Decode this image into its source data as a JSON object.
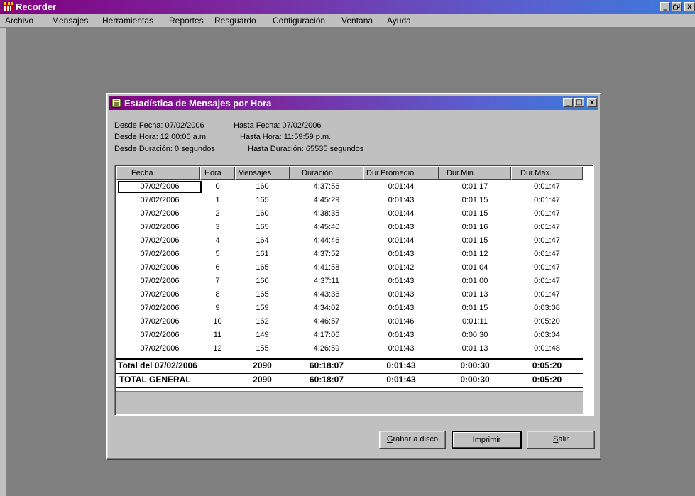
{
  "app": {
    "title": "Recorder",
    "controls": {
      "minimize": "_",
      "restore": "8",
      "close": "x"
    }
  },
  "menubar": {
    "items": [
      "Archivo",
      "Mensajes",
      "Herramientas",
      "Reportes",
      "Resguardo",
      "Configuración",
      "Ventana",
      "Ayuda"
    ]
  },
  "dialog": {
    "title": "Estadística de Mensajes por Hora",
    "controls": {
      "minimize": "_",
      "maximize": "□",
      "close": "x"
    },
    "info": {
      "desde_fecha": "Desde Fecha: 07/02/2006",
      "hasta_fecha": "Hasta Fecha: 07/02/2006",
      "desde_hora": "Desde Hora: 12:00:00 a.m.",
      "hasta_hora": "Hasta Hora: 11:59:59 p.m.",
      "desde_duracion": "Desde Duración: 0 segundos",
      "hasta_duracion": "Hasta Duración: 65535 segundos"
    },
    "table": {
      "columns": [
        "Fecha",
        "Hora",
        "Mensajes",
        "Duración",
        "Dur.Promedio",
        "Dur.Min.",
        "Dur.Max."
      ],
      "rows": [
        [
          "07/02/2006",
          "0",
          "160",
          "4:37:56",
          "0:01:44",
          "0:01:17",
          "0:01:47"
        ],
        [
          "07/02/2006",
          "1",
          "165",
          "4:45:29",
          "0:01:43",
          "0:01:15",
          "0:01:47"
        ],
        [
          "07/02/2006",
          "2",
          "160",
          "4:38:35",
          "0:01:44",
          "0:01:15",
          "0:01:47"
        ],
        [
          "07/02/2006",
          "3",
          "165",
          "4:45:40",
          "0:01:43",
          "0:01:16",
          "0:01:47"
        ],
        [
          "07/02/2006",
          "4",
          "164",
          "4:44:46",
          "0:01:44",
          "0:01:15",
          "0:01:47"
        ],
        [
          "07/02/2006",
          "5",
          "161",
          "4:37:52",
          "0:01:43",
          "0:01:12",
          "0:01:47"
        ],
        [
          "07/02/2006",
          "6",
          "165",
          "4:41:58",
          "0:01:42",
          "0:01:04",
          "0:01:47"
        ],
        [
          "07/02/2006",
          "7",
          "160",
          "4:37:11",
          "0:01:43",
          "0:01:00",
          "0:01:47"
        ],
        [
          "07/02/2006",
          "8",
          "165",
          "4:43:36",
          "0:01:43",
          "0:01:13",
          "0:01:47"
        ],
        [
          "07/02/2006",
          "9",
          "159",
          "4:34:02",
          "0:01:43",
          "0:01:15",
          "0:03:08"
        ],
        [
          "07/02/2006",
          "10",
          "162",
          "4:46:57",
          "0:01:46",
          "0:01:11",
          "0:05:20"
        ],
        [
          "07/02/2006",
          "11",
          "149",
          "4:17:06",
          "0:01:43",
          "0:00:30",
          "0:03:04"
        ],
        [
          "07/02/2006",
          "12",
          "155",
          "4:26:59",
          "0:01:43",
          "0:01:13",
          "0:01:48"
        ]
      ],
      "total_day": [
        "Total del 07/02/2006",
        "2090",
        "60:18:07",
        "0:01:43",
        "0:00:30",
        "0:05:20"
      ],
      "total_general": [
        "TOTAL GENERAL",
        "2090",
        "60:18:07",
        "0:01:43",
        "0:00:30",
        "0:05:20"
      ]
    },
    "buttons": {
      "grabar": "rabar a disco",
      "grabar_key": "G",
      "imprimir": "mprimir",
      "imprimir_key": "I",
      "salir": "alir",
      "salir_key": "S"
    }
  }
}
